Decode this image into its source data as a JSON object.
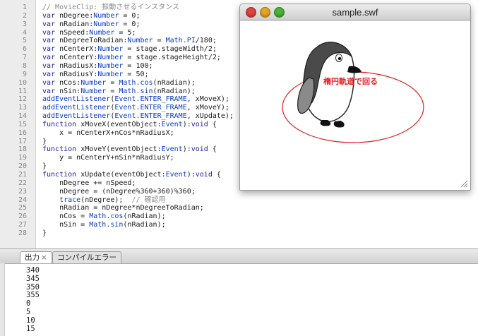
{
  "editor": {
    "lines": [
      {
        "n": "1",
        "html": "<span class='cmt'>// MovieClip: 振動させるインスタンス</span>"
      },
      {
        "n": "2",
        "html": "<span class='kw'>var</span> nDegree:<span class='blue'>Number</span> = 0;"
      },
      {
        "n": "3",
        "html": "<span class='kw'>var</span> nRadian:<span class='blue'>Number</span> = 0;"
      },
      {
        "n": "4",
        "html": "<span class='kw'>var</span> nSpeed:<span class='blue'>Number</span> = 5;"
      },
      {
        "n": "5",
        "html": "<span class='kw'>var</span> nDegreeToRadian:<span class='blue'>Number</span> = <span class='blue'>Math.PI</span>/180;"
      },
      {
        "n": "6",
        "html": "<span class='kw'>var</span> nCenterX:<span class='blue'>Number</span> = stage.stageWidth/2;"
      },
      {
        "n": "7",
        "html": "<span class='kw'>var</span> nCenterY:<span class='blue'>Number</span> = stage.stageHeight/2;"
      },
      {
        "n": "8",
        "html": "<span class='kw'>var</span> nRadiusX:<span class='blue'>Number</span> = 100;"
      },
      {
        "n": "9",
        "html": "<span class='kw'>var</span> nRadiusY:<span class='blue'>Number</span> = 50;"
      },
      {
        "n": "10",
        "html": "<span class='kw'>var</span> nCos:<span class='blue'>Number</span> = <span class='blue'>Math.cos</span>(nRadian);"
      },
      {
        "n": "11",
        "html": "<span class='kw'>var</span> nSin:<span class='blue'>Number</span> = <span class='blue'>Math.sin</span>(nRadian);"
      },
      {
        "n": "12",
        "html": "<span class='blue'>addEventListener</span>(<span class='blue'>Event.ENTER_FRAME</span>, xMoveX);"
      },
      {
        "n": "13",
        "html": "<span class='blue'>addEventListener</span>(<span class='blue'>Event.ENTER_FRAME</span>, xMoveY);"
      },
      {
        "n": "14",
        "html": "<span class='blue'>addEventListener</span>(<span class='blue'>Event.ENTER_FRAME</span>, xUpdate);"
      },
      {
        "n": "15",
        "html": "<span class='kw'>function</span> xMoveX(eventObject:<span class='blue'>Event</span>):<span class='kw'>void</span> {"
      },
      {
        "n": "16",
        "html": "    x = nCenterX+nCos*nRadiusX;"
      },
      {
        "n": "17",
        "html": "}"
      },
      {
        "n": "18",
        "html": "<span class='kw'>function</span> xMoveY(eventObject:<span class='blue'>Event</span>):<span class='kw'>void</span> {"
      },
      {
        "n": "19",
        "html": "    y = nCenterY+nSin*nRadiusY;"
      },
      {
        "n": "20",
        "html": "}"
      },
      {
        "n": "21",
        "html": "<span class='kw'>function</span> xUpdate(eventObject:<span class='blue'>Event</span>):<span class='kw'>void</span> {"
      },
      {
        "n": "22",
        "html": "    nDegree += nSpeed;"
      },
      {
        "n": "23",
        "html": "    nDegree = (nDegree%360+360)%360;"
      },
      {
        "n": "24",
        "html": "    <span class='blue'>trace</span>(nDegree);  <span class='cmt'>// 確認用</span>"
      },
      {
        "n": "25",
        "html": "    nRadian = nDegree*nDegreeToRadian;"
      },
      {
        "n": "26",
        "html": "    nCos = <span class='blue'>Math.cos</span>(nRadian);"
      },
      {
        "n": "27",
        "html": "    nSin = <span class='blue'>Math.sin</span>(nRadian);"
      },
      {
        "n": "28",
        "html": "}"
      }
    ]
  },
  "swf_window": {
    "title": "sample.swf",
    "stage_label": "楕円軌道で回る",
    "ellipse_color": "#e02020"
  },
  "output_panel": {
    "tabs": [
      {
        "label": "出力",
        "close": "×"
      },
      {
        "label": "コンパイルエラー"
      }
    ],
    "lines": [
      "340",
      "345",
      "350",
      "355",
      "0",
      "5",
      "10",
      "15"
    ]
  }
}
